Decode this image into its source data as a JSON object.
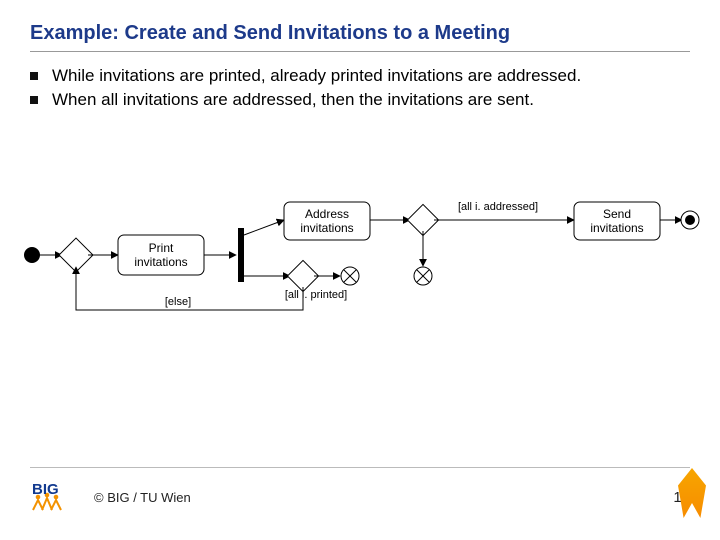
{
  "title": "Example: Create and Send Invitations to a Meeting",
  "bullets": [
    "While invitations are printed, already printed invitations are addressed.",
    "When all invitations are addressed, then the invitations are sent."
  ],
  "diagram": {
    "actions": {
      "print": "Print\ninvitations",
      "address": "Address\ninvitations",
      "send": "Send\ninvitations"
    },
    "guards": {
      "else": "[else]",
      "all_printed": "[all i. printed]",
      "all_addressed": "[all i. addressed]"
    }
  },
  "footer": {
    "copyright": "© BIG / TU Wien",
    "page": "16",
    "brand": "BIG"
  }
}
